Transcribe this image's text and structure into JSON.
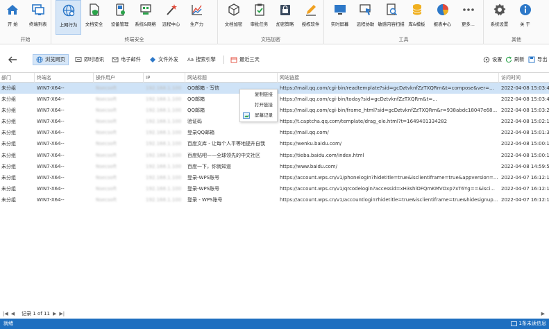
{
  "ribbon": {
    "groups": [
      {
        "name": "开始",
        "items": [
          {
            "label": "开 始",
            "icon": "home-icon"
          },
          {
            "label": "终端列表",
            "icon": "monitor-list-icon"
          }
        ]
      },
      {
        "name": "终端安全",
        "items": [
          {
            "label": "上网行为",
            "icon": "globe-icon",
            "active": true
          },
          {
            "label": "文档安全",
            "icon": "document-shield-icon"
          },
          {
            "label": "设备管理",
            "icon": "device-icon"
          },
          {
            "label": "系统&网络",
            "icon": "network-icon"
          },
          {
            "label": "远程中心",
            "icon": "remote-wand-icon"
          },
          {
            "label": "生产力",
            "icon": "chart-icon"
          }
        ]
      },
      {
        "name": "文档加密",
        "items": [
          {
            "label": "文档加密",
            "icon": "cube-icon"
          },
          {
            "label": "审批任务",
            "icon": "clipboard-check-icon"
          },
          {
            "label": "加密策略",
            "icon": "lock-policy-icon"
          },
          {
            "label": "授权软件",
            "icon": "pen-icon"
          }
        ]
      },
      {
        "name": "工具",
        "items": [
          {
            "label": "实时屏幕",
            "icon": "screen-icon"
          },
          {
            "label": "远程协助",
            "icon": "remote-assist-icon"
          },
          {
            "label": "敏感内容扫描",
            "icon": "scan-icon"
          },
          {
            "label": "库&模板",
            "icon": "database-icon"
          },
          {
            "label": "报表中心",
            "icon": "pie-chart-icon"
          },
          {
            "label": "更多...",
            "icon": "more-icon"
          }
        ]
      },
      {
        "name": "其他",
        "items": [
          {
            "label": "系统设置",
            "icon": "gear-icon"
          },
          {
            "label": "关 于",
            "icon": "info-icon"
          }
        ]
      }
    ]
  },
  "toolbar": {
    "tabs": [
      {
        "label": "浏览网页",
        "icon": "web-icon",
        "active": true
      },
      {
        "label": "即时通讯",
        "icon": "chat-icon"
      },
      {
        "label": "电子邮件",
        "icon": "mail-icon"
      },
      {
        "label": "文件外发",
        "icon": "file-send-icon"
      },
      {
        "label": "搜索引擎",
        "icon": "search-engine-icon"
      }
    ],
    "date_filter": "最近三天",
    "settings": "设置",
    "refresh": "刷新",
    "export": "导出"
  },
  "table": {
    "columns": [
      "部门",
      "终端名",
      "操作用户",
      "IP",
      "网站标题",
      "网站链接",
      "访问时间"
    ],
    "rows": [
      [
        "未分组",
        "WIN7-X64--",
        "Nsecsoft",
        "192.168.1.100",
        "QQ邮箱 - 写信",
        "https://mail.qq.com/cgi-bin/readtemplate?sid=gcDztvknfZzTXQRm&t=compose&ver=...",
        "2022-04-08 15:03:47"
      ],
      [
        "未分组",
        "WIN7-X64--",
        "Nsecsoft",
        "192.168.1.100",
        "QQ邮箱",
        "https://mail.qq.com/cgi-bin/today?sid=gcDztvknfZzTXQRm&t=...",
        "2022-04-08 15:03:42"
      ],
      [
        "未分组",
        "WIN7-X64--",
        "Nsecsoft",
        "192.168.1.100",
        "QQ邮箱",
        "https://mail.qq.com/cgi-bin/frame_html?sid=gcDztvknfZzTXQRm&r=938abdc18047e68...",
        "2022-04-08 15:03:26"
      ],
      [
        "未分组",
        "WIN7-X64--",
        "Nsecsoft",
        "192.168.1.100",
        "验证码",
        "https://t.captcha.qq.com/template/drag_ele.html?t=1649401334282",
        "2022-04-08 15:02:14"
      ],
      [
        "未分组",
        "WIN7-X64--",
        "Nsecsoft",
        "192.168.1.100",
        "登录QQ邮箱",
        "https://mail.qq.com/",
        "2022-04-08 15:01:37"
      ],
      [
        "未分组",
        "WIN7-X64--",
        "Nsecsoft",
        "192.168.1.100",
        "百度文库 - 让每个人平等地提升自我",
        "https://wenku.baidu.com/",
        "2022-04-08 15:00:19"
      ],
      [
        "未分组",
        "WIN7-X64--",
        "Nsecsoft",
        "192.168.1.100",
        "百度贴吧——全球领先的中文社区",
        "https://tieba.baidu.com/index.html",
        "2022-04-08 15:00:12"
      ],
      [
        "未分组",
        "WIN7-X64--",
        "Nsecsoft",
        "192.168.1.100",
        "百度一下，你就知道",
        "https://www.baidu.com/",
        "2022-04-08 14:59:50"
      ],
      [
        "未分组",
        "WIN7-X64--",
        "Nsecsoft",
        "192.168.1.100",
        "登录-WPS账号",
        "https://account.wps.cn/v1/phonelogin?hidetitle=true&isclientiframe=true&appversion=...",
        "2022-04-07 16:12:15"
      ],
      [
        "未分组",
        "WIN7-X64--",
        "Nsecsoft",
        "192.168.1.100",
        "登录-WPS账号",
        "https://account.wps.cn/v1/qrcodelogin?accessid=xH3shlOFQmKMVOxp7xT6Yg==&isci...",
        "2022-04-07 16:12:15"
      ],
      [
        "未分组",
        "WIN7-X64--",
        "Nsecsoft",
        "192.168.1.100",
        "登录 - WPS账号",
        "https://account.wps.cn/v1/accountlogin?hidetitle=true&isclientiframe=true&hidesignup...",
        "2022-04-07 16:12:14"
      ]
    ],
    "selected_row": 0
  },
  "context_menu": {
    "items": [
      {
        "label": "复制链接",
        "icon": ""
      },
      {
        "label": "打开链接",
        "icon": ""
      },
      {
        "label": "屏幕记录",
        "icon": "screen-record-icon"
      }
    ]
  },
  "pager": {
    "text": "记录 1 of 11"
  },
  "status": {
    "left": "就绪",
    "right": "1条未读信息"
  },
  "colors": {
    "accent": "#1e6fc0",
    "selected": "#cfe3f7",
    "active_border": "#a9c9ee"
  }
}
